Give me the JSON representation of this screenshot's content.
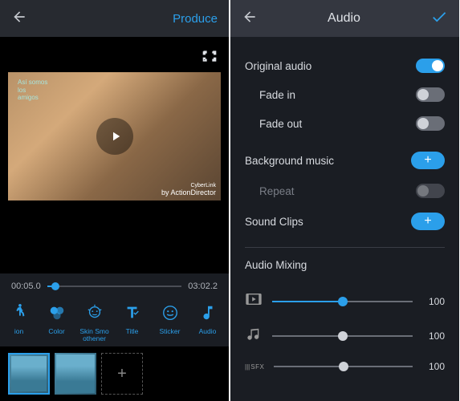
{
  "left": {
    "header": {
      "produce": "Produce"
    },
    "video": {
      "overlay_text": "Así somos\nlos\namigos",
      "watermark_small": "CyberLink",
      "watermark_brand": "ActionDirector"
    },
    "timeline": {
      "current": "00:05.0",
      "total": "03:02.2"
    },
    "tools": [
      {
        "label": "ion"
      },
      {
        "label": "Color"
      },
      {
        "label": "Skin Smo\nothener"
      },
      {
        "label": "Title"
      },
      {
        "label": "Sticker"
      },
      {
        "label": "Audio"
      }
    ],
    "add_clip": "+"
  },
  "right": {
    "title": "Audio",
    "original_audio": "Original audio",
    "fade_in": "Fade in",
    "fade_out": "Fade out",
    "bg_music": "Background music",
    "repeat": "Repeat",
    "sound_clips": "Sound Clips",
    "add": "+",
    "mixing": "Audio Mixing",
    "sfx": "SFX",
    "levels": {
      "video": "100",
      "music": "100",
      "sfx": "100"
    }
  }
}
